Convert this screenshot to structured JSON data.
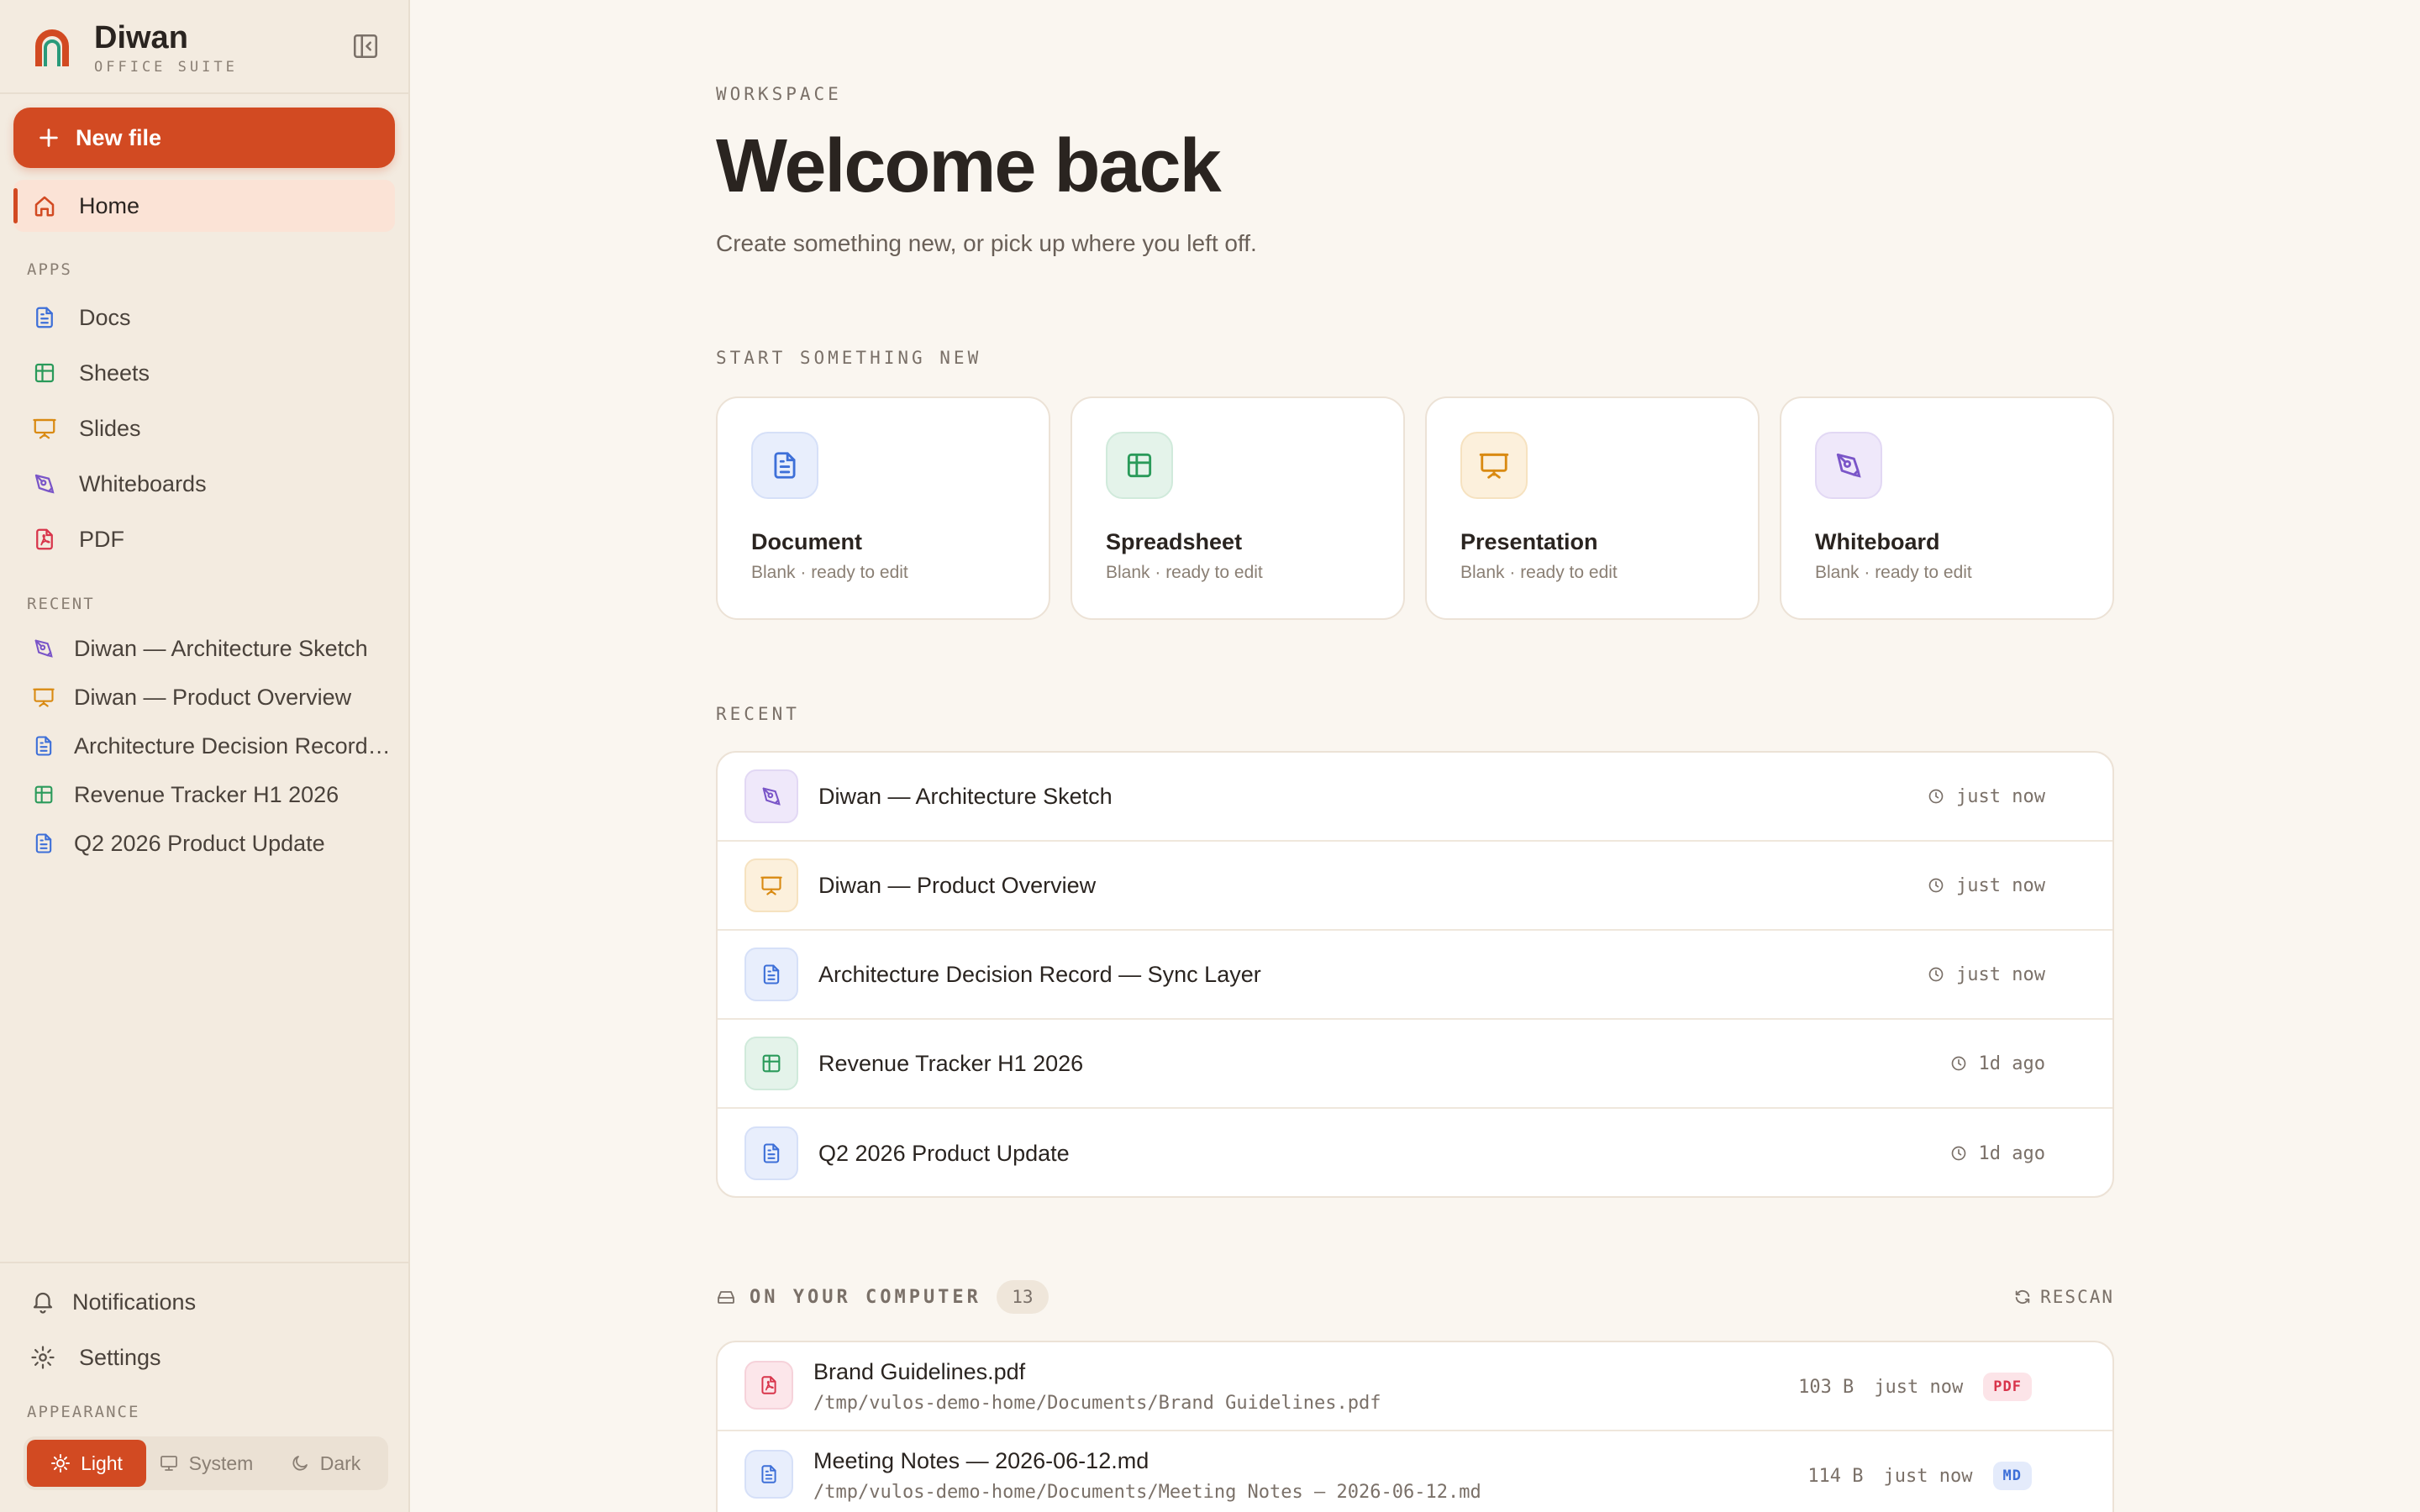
{
  "brand": {
    "name": "Diwan",
    "subtitle": "OFFICE SUITE"
  },
  "sidebar": {
    "new_file_label": "New file",
    "home_label": "Home",
    "apps_heading": "APPS",
    "apps": [
      {
        "label": "Docs",
        "icon": "doc-icon",
        "color": "#3d6fd8"
      },
      {
        "label": "Sheets",
        "icon": "sheet-icon",
        "color": "#2a9a5a"
      },
      {
        "label": "Slides",
        "icon": "slide-icon",
        "color": "#d98a12"
      },
      {
        "label": "Whiteboards",
        "icon": "pen-icon",
        "color": "#7a55c8"
      },
      {
        "label": "PDF",
        "icon": "pdf-icon",
        "color": "#d8344a"
      }
    ],
    "recent_heading": "RECENT",
    "recent": [
      {
        "label": "Diwan — Architecture Sketch",
        "icon": "pen-icon"
      },
      {
        "label": "Diwan — Product Overview",
        "icon": "slide-icon"
      },
      {
        "label": "Architecture Decision Record — Sync Layer",
        "icon": "doc-icon"
      },
      {
        "label": "Revenue Tracker H1 2026",
        "icon": "sheet-icon"
      },
      {
        "label": "Q2 2026 Product Update",
        "icon": "doc-icon"
      }
    ],
    "notifications_label": "Notifications",
    "settings_label": "Settings",
    "appearance_heading": "APPEARANCE",
    "theme_options": [
      "Light",
      "System",
      "Dark"
    ],
    "theme_selected": "Light"
  },
  "main": {
    "eyebrow": "WORKSPACE",
    "title": "Welcome back",
    "subtitle": "Create something new, or pick up where you left off.",
    "start_heading": "START SOMETHING NEW",
    "cards": [
      {
        "title": "Document",
        "subtitle": "Blank · ready to edit"
      },
      {
        "title": "Spreadsheet",
        "subtitle": "Blank · ready to edit"
      },
      {
        "title": "Presentation",
        "subtitle": "Blank · ready to edit"
      },
      {
        "title": "Whiteboard",
        "subtitle": "Blank · ready to edit"
      }
    ],
    "recent_heading": "RECENT",
    "recent": [
      {
        "title": "Diwan — Architecture Sketch",
        "time": "just now",
        "icon": "pen-icon"
      },
      {
        "title": "Diwan — Product Overview",
        "time": "just now",
        "icon": "slide-icon"
      },
      {
        "title": "Architecture Decision Record — Sync Layer",
        "time": "just now",
        "icon": "doc-icon"
      },
      {
        "title": "Revenue Tracker H1 2026",
        "time": "1d ago",
        "icon": "sheet-icon"
      },
      {
        "title": "Q2 2026 Product Update",
        "time": "1d ago",
        "icon": "doc-icon"
      }
    ],
    "computer": {
      "heading": "ON YOUR COMPUTER",
      "count": "13",
      "rescan_label": "RESCAN",
      "files": [
        {
          "name": "Brand Guidelines.pdf",
          "path": "/tmp/vulos-demo-home/Documents/Brand Guidelines.pdf",
          "size": "103 B",
          "time": "just now",
          "tag": "PDF"
        },
        {
          "name": "Meeting Notes — 2026-06-12.md",
          "path": "/tmp/vulos-demo-home/Documents/Meeting Notes — 2026-06-12.md",
          "size": "114 B",
          "time": "just now",
          "tag": "MD"
        }
      ]
    }
  },
  "colors": {
    "accent": "#d24a22",
    "doc": "#3d6fd8",
    "sheet": "#2a9a5a",
    "slide": "#d98a12",
    "whiteboard": "#7a55c8",
    "pdf": "#d8344a"
  }
}
